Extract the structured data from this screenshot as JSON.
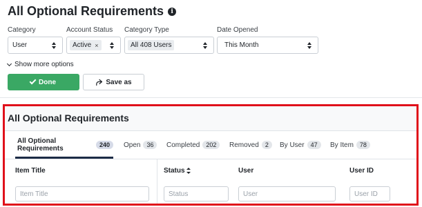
{
  "page": {
    "title": "All Optional Requirements"
  },
  "filters": {
    "category": {
      "label": "Category",
      "value": "User"
    },
    "account_status": {
      "label": "Account Status",
      "chip": "Active",
      "chip_remove": "×"
    },
    "category_type": {
      "label": "Category Type",
      "value": "All 408 Users"
    },
    "date_opened": {
      "label": "Date Opened",
      "value": "This Month"
    }
  },
  "more_options": {
    "label": "Show more options"
  },
  "actions": {
    "done_label": "Done",
    "save_as_label": "Save as"
  },
  "panel": {
    "title": "All Optional Requirements",
    "tabs": [
      {
        "label": "All Optional Requirements",
        "count": "240"
      },
      {
        "label": "Open",
        "count": "36"
      },
      {
        "label": "Completed",
        "count": "202"
      },
      {
        "label": "Removed",
        "count": "2"
      },
      {
        "label": "By User",
        "count": "47"
      },
      {
        "label": "By Item",
        "count": "78"
      }
    ],
    "columns": [
      {
        "header": "Item Title",
        "placeholder": "Item Title"
      },
      {
        "header": "Status",
        "placeholder": "Status"
      },
      {
        "header": "User",
        "placeholder": "User"
      },
      {
        "header": "User ID",
        "placeholder": "User ID"
      }
    ]
  },
  "colors": {
    "primary": "#3aa864",
    "highlight_border": "#e0101a",
    "active_tab": "#1c2b45"
  }
}
